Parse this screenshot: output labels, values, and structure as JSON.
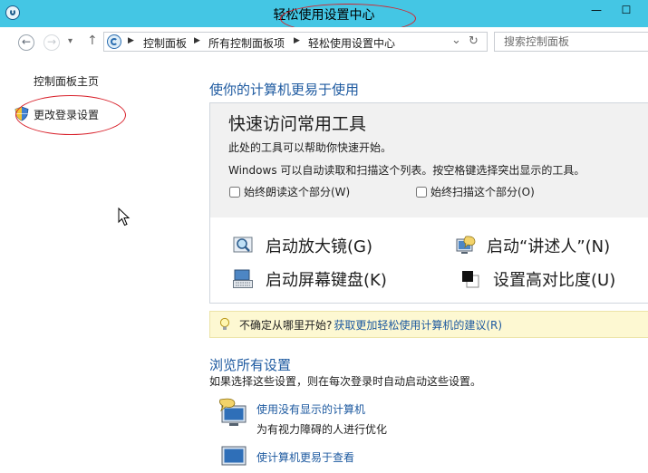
{
  "window": {
    "title": "轻松使用设置中心",
    "minimize_glyph": "—",
    "maximize_glyph": "☐"
  },
  "addressbar": {
    "back_glyph": "←",
    "forward_glyph": "→",
    "recent_glyph": "▾",
    "up_glyph": "↑",
    "breadcrumbs": [
      "控制面板",
      "所有控制面板项",
      "轻松使用设置中心"
    ],
    "dropdown_glyph": "⌄",
    "refresh_glyph": "↻",
    "search_placeholder": "搜索控制面板"
  },
  "sidebar": {
    "home_label": "控制面板主页",
    "login_settings_label": "更改登录设置"
  },
  "main": {
    "heading": "使你的计算机更易于使用",
    "quick_access": {
      "title": "快速访问常用工具",
      "line1": "此处的工具可以帮助你快速开始。",
      "line2": "Windows 可以自动读取和扫描这个列表。按空格键选择突出显示的工具。",
      "read_aloud_label": "始终朗读这个部分(W)",
      "scan_label": "始终扫描这个部分(O)",
      "read_aloud_checked": false,
      "scan_checked": false,
      "tools": {
        "magnifier": "启动放大镜(G)",
        "narrator": "启动“讲述人”(N)",
        "keyboard": "启动屏幕键盘(K)",
        "contrast": "设置高对比度(U)"
      }
    },
    "hint": {
      "text": "不确定从哪里开始?",
      "link": "获取更加轻松使用计算机的建议(R)"
    },
    "browse": {
      "heading": "浏览所有设置",
      "subtitle": "如果选择这些设置，则在每次登录时自动启动这些设置。",
      "items": [
        {
          "title": "使用没有显示的计算机",
          "desc": "为有视力障碍的人进行优化"
        },
        {
          "title": "使计算机更易于查看"
        }
      ]
    }
  },
  "colors": {
    "titlebar": "#44c6e4",
    "link_blue": "#1e5aa0",
    "annotation_red": "#d8202a",
    "hint_background": "#fdf8d2",
    "panel_background": "#f1f1f1"
  },
  "icons": [
    "control-panel-icon",
    "shield-icon",
    "magnifier-icon",
    "narrator-icon",
    "keyboard-icon",
    "contrast-icon",
    "lightbulb-icon",
    "monitor-speech-icon",
    "monitor-icon"
  ]
}
